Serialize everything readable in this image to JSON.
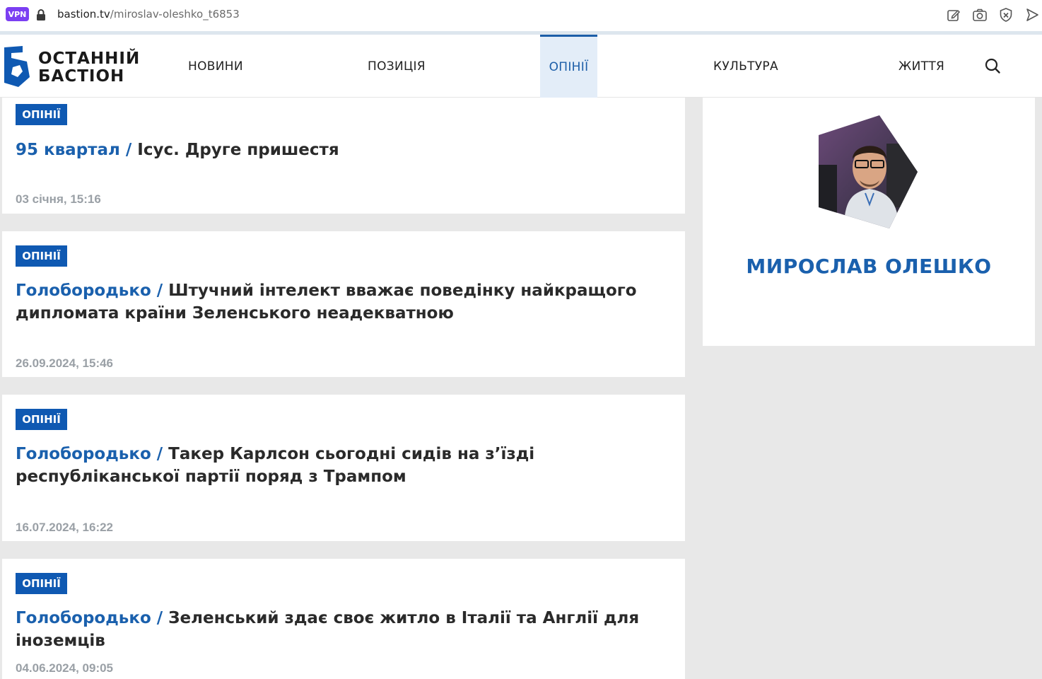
{
  "browser": {
    "vpn_label": "VPN",
    "url_host": "bastion.tv",
    "url_path": "/miroslav-oleshko_t6853"
  },
  "site": {
    "logo_line1": "ОСТАННІЙ",
    "logo_line2": "БАСТІОН",
    "nav": [
      {
        "label": "НОВИНИ"
      },
      {
        "label": "ПОЗИЦІЯ"
      },
      {
        "label": "ОПІНІЇ"
      },
      {
        "label": "КУЛЬТУРА"
      },
      {
        "label": "ЖИТТЯ"
      }
    ],
    "accent_color": "#1c5ea8"
  },
  "articles": [
    {
      "badge": "ОПІНІЇ",
      "author": "95 квартал /",
      "title": " Ісус. Друге пришестя",
      "date": "03 січня, 15:16"
    },
    {
      "badge": "ОПІНІЇ",
      "author": "Голобородько /",
      "title": " Штучний інтелект вважає поведінку найкращого дипломата країни Зеленського неадекватною",
      "date": "26.09.2024, 15:46"
    },
    {
      "badge": "ОПІНІЇ",
      "author": "Голобородько /",
      "title": " Такер Карлсон сьогодні сидів на з’їзді республіканської партії поряд з Трампом",
      "date": "16.07.2024, 16:22"
    },
    {
      "badge": "ОПІНІЇ",
      "author": "Голобородько /",
      "title": " Зеленський здає своє житло в Італії та Англії для іноземців",
      "date": "04.06.2024, 09:05"
    }
  ],
  "sidebar": {
    "author_name": "МИРОСЛАВ ОЛЕШКО"
  }
}
